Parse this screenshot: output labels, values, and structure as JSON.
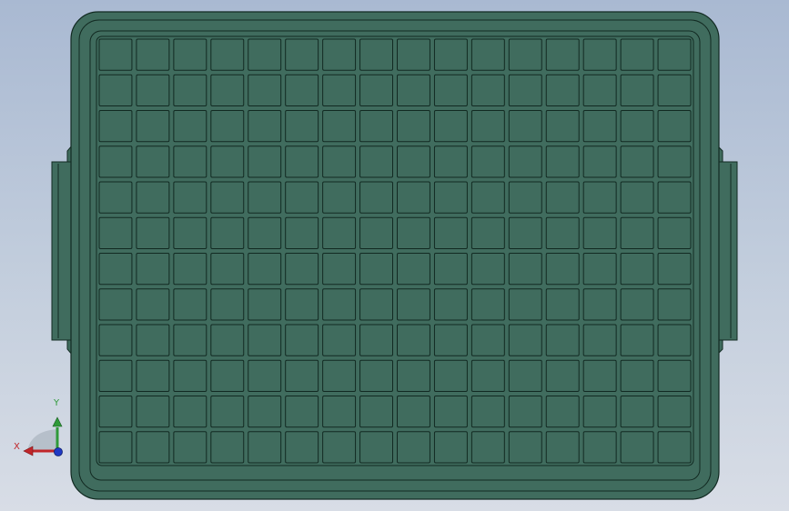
{
  "viewport": {
    "background_top": "#a9b9d2",
    "background_bottom": "#d8dde6"
  },
  "part": {
    "name": "tray",
    "color_fill": "#406c5e",
    "color_edge": "#122a22",
    "color_handle_highlight": "#a6c7b6",
    "grid": {
      "rows": 12,
      "columns": 16
    }
  },
  "triad": {
    "x_label": "X",
    "y_label": "Y",
    "x_color": "#c0262a",
    "y_color": "#2f9a39",
    "z_color": "#1f39c4"
  }
}
